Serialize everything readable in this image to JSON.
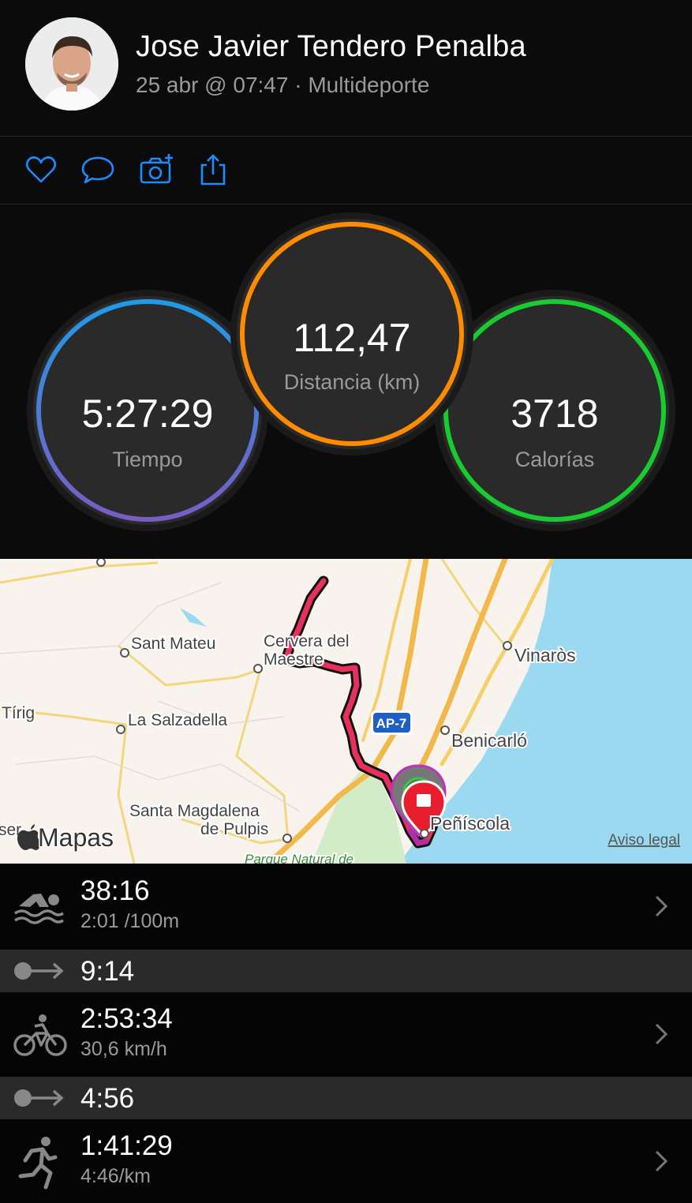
{
  "header": {
    "name": "Jose Javier Tendero Penalba",
    "meta": "25 abr @ 07:47 · Multideporte"
  },
  "actions": {
    "icons": [
      "heart-icon",
      "comment-icon",
      "camera-add-icon",
      "share-icon"
    ],
    "accent_color": "#1a8cff"
  },
  "stats": {
    "time": {
      "value": "5:27:29",
      "label": "Tiempo",
      "colors": [
        "#1e9be8",
        "#7a5cc4"
      ]
    },
    "distance": {
      "value": "112,47",
      "label": "Distancia (km)",
      "color": "#ff8c00"
    },
    "calories": {
      "value": "3718",
      "label": "Calorías",
      "color": "#18cc30"
    }
  },
  "map": {
    "places": [
      "Sant Mateu",
      "Cervera del",
      "Maestre",
      "Vinaròs",
      "Tírig",
      "La Salzadella",
      "Benicarló",
      "Santa Magdalena",
      "de Pulpis",
      "Peñíscola",
      "Parque Natural de",
      "ser"
    ],
    "highway": "AP-7",
    "brand": "Mapas",
    "legal": "Aviso legal",
    "route_color": "#e8315a"
  },
  "segments": [
    {
      "icon": "swim-icon",
      "time": "38:16",
      "pace": "2:01 /100m"
    },
    {
      "icon": "transition-icon",
      "time": "9:14"
    },
    {
      "icon": "bike-icon",
      "time": "2:53:34",
      "pace": "30,6 km/h"
    },
    {
      "icon": "transition-icon",
      "time": "4:56"
    },
    {
      "icon": "run-icon",
      "time": "1:41:29",
      "pace": "4:46/km"
    }
  ]
}
